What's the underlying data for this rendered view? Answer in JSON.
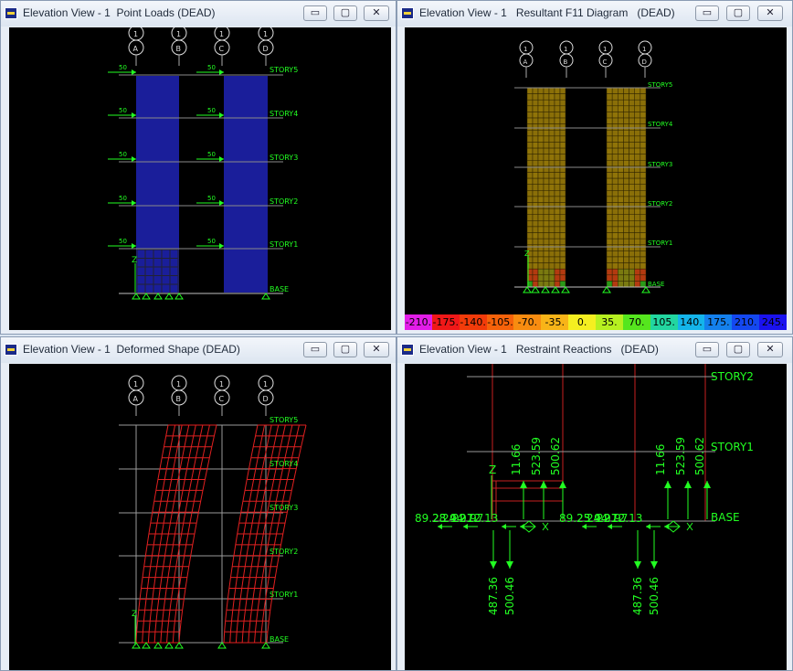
{
  "windows": [
    {
      "title": "Elevation View - 1  Point Loads (DEAD)"
    },
    {
      "title": "Elevation View - 1   Resultant F11 Diagram   (DEAD)"
    },
    {
      "title": "Elevation View - 1  Deformed Shape (DEAD)"
    },
    {
      "title": "Elevation View - 1   Restraint Reactions   (DEAD)"
    }
  ],
  "controls": {
    "minimize": "▭",
    "maximize": "▢",
    "close": "✕"
  },
  "grid_bubbles": [
    {
      "num": "1",
      "letter": "A"
    },
    {
      "num": "1",
      "letter": "B"
    },
    {
      "num": "1",
      "letter": "C"
    },
    {
      "num": "1",
      "letter": "D"
    }
  ],
  "stories": [
    "STORY5",
    "STORY4",
    "STORY3",
    "STORY2",
    "STORY1",
    "BASE"
  ],
  "point_loads": [
    "50",
    "50",
    "50",
    "50",
    "50"
  ],
  "axis_label": "Z",
  "legend": {
    "labels": [
      "-210.",
      "-175.",
      "-140.",
      "-105.",
      "-70.",
      "-35.",
      "0.",
      "35.",
      "70.",
      "105.",
      "140.",
      "175.",
      "210.",
      "245."
    ],
    "colors": [
      "#e21de8",
      "#f01818",
      "#f23b0a",
      "#f6620a",
      "#f88c10",
      "#f8b418",
      "#f5ef20",
      "#b6f020",
      "#55e61e",
      "#22d6a0",
      "#14b4ea",
      "#1480ec",
      "#1448f0",
      "#1a12ee"
    ]
  },
  "reactions": {
    "stories": [
      "STORY2",
      "STORY1",
      "BASE"
    ],
    "left_group": {
      "horizontal": [
        "89.23",
        "28.94",
        "24.97",
        "22.97",
        "12.13"
      ],
      "up": [
        "11.66",
        "523.59",
        "500.62"
      ],
      "down": [
        "487.36",
        "500.46"
      ]
    },
    "right_group": {
      "horizontal": [
        "89.23",
        "25.94",
        "24.97",
        "22.97",
        "12.13"
      ],
      "up": [
        "11.66",
        "523.59",
        "500.62"
      ],
      "down": [
        "487.36",
        "500.46"
      ]
    }
  }
}
